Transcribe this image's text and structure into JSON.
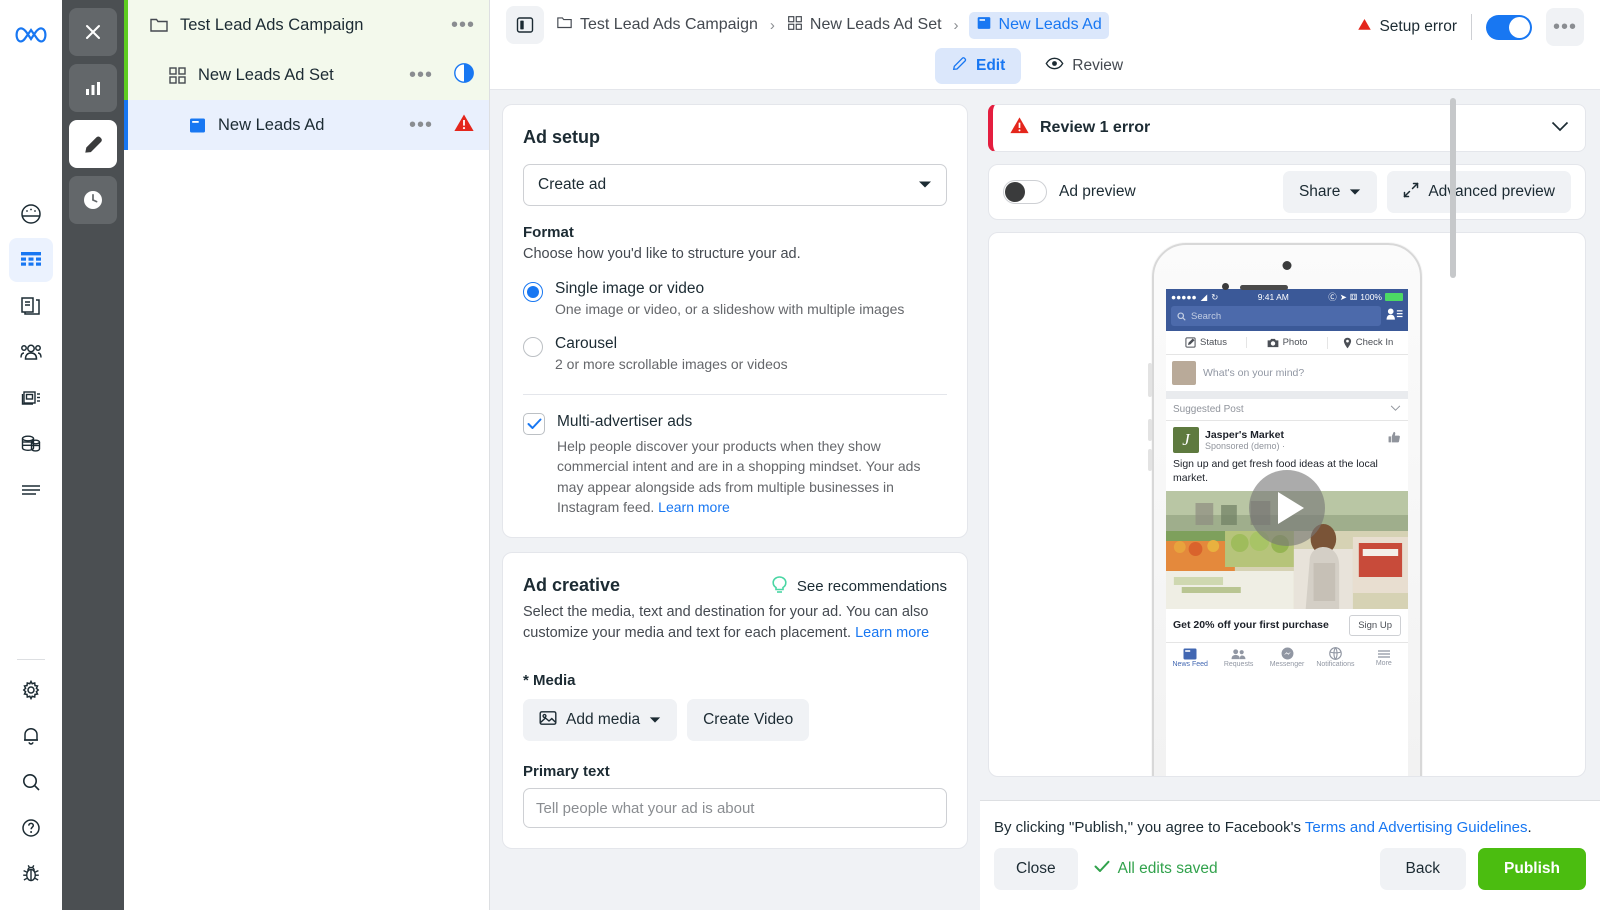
{
  "brand": {
    "logo": "meta-logo",
    "accent": "#1877f2",
    "green": "#4bbd10",
    "error_red": "#e41e3f"
  },
  "rail_left": {
    "top_items": [
      {
        "name": "performance-icon",
        "label": "Performance"
      },
      {
        "name": "table-icon",
        "label": "Campaigns",
        "active": true
      },
      {
        "name": "pages-icon",
        "label": "Pages"
      },
      {
        "name": "audiences-icon",
        "label": "Audiences"
      },
      {
        "name": "catalog-icon",
        "label": "Catalogue"
      },
      {
        "name": "billing-icon",
        "label": "Billing"
      },
      {
        "name": "menu-icon",
        "label": "All tools"
      }
    ],
    "bottom_items": [
      {
        "name": "gear-icon",
        "label": "Settings"
      },
      {
        "name": "bell-icon",
        "label": "Notifications"
      },
      {
        "name": "search-icon",
        "label": "Search"
      },
      {
        "name": "help-icon",
        "label": "Help"
      },
      {
        "name": "bug-icon",
        "label": "Report a bug"
      }
    ]
  },
  "rail_dark": {
    "items": [
      {
        "name": "close-icon",
        "label": "Close"
      },
      {
        "name": "chart-icon",
        "label": "Charts"
      },
      {
        "name": "edit-pencil-icon",
        "label": "Edit",
        "active": true
      },
      {
        "name": "clock-icon",
        "label": "History"
      }
    ]
  },
  "tree": {
    "rows": [
      {
        "icon": "folder-icon",
        "label": "Test Lead Ads Campaign",
        "level": "campaign",
        "status": null
      },
      {
        "icon": "grid-icon",
        "label": "New Leads Ad Set",
        "level": "adset",
        "status": "half-circle-icon"
      },
      {
        "icon": "ad-icon",
        "label": "New Leads Ad",
        "level": "ad",
        "status": "warning-triangle-icon"
      }
    ],
    "overflow_label": "•••"
  },
  "topbar": {
    "panel_toggle": "panel-toggle-icon",
    "breadcrumb": [
      {
        "icon": "folder-icon",
        "label": "Test Lead Ads Campaign",
        "active": false
      },
      {
        "icon": "grid-icon",
        "label": "New Leads Ad Set",
        "active": false
      },
      {
        "icon": "ad-icon",
        "label": "New Leads Ad",
        "active": true
      }
    ],
    "separator": "›",
    "setup_error": "Setup error",
    "toggle_on": true,
    "kebab": "•••",
    "tabs": [
      {
        "icon": "pencil-icon",
        "label": "Edit",
        "active": true
      },
      {
        "icon": "eye-icon",
        "label": "Review",
        "active": false
      }
    ]
  },
  "ad_setup": {
    "title": "Ad setup",
    "create_select_value": "Create ad",
    "format_label": "Format",
    "format_sub": "Choose how you'd like to structure your ad.",
    "options": [
      {
        "title": "Single image or video",
        "sub": "One image or video, or a slideshow with multiple images",
        "selected": true
      },
      {
        "title": "Carousel",
        "sub": "2 or more scrollable images or videos",
        "selected": false
      }
    ],
    "multi_advertiser": {
      "label": "Multi-advertiser ads",
      "checked": true,
      "description": "Help people discover your products when they show commercial intent and are in a shopping mindset. Your ads may appear alongside ads from multiple businesses in Instagram feed.",
      "link": "Learn more"
    }
  },
  "ad_creative": {
    "title": "Ad creative",
    "recommendations": "See recommendations",
    "recommendations_icon": "lightbulb-icon",
    "description": "Select the media, text and destination for your ad. You can also customize your media and text for each placement.",
    "link": "Learn more",
    "media_label": "* Media",
    "add_media_button": "Add media",
    "add_media_icon": "image-icon",
    "create_video_button": "Create Video",
    "primary_text_label": "Primary text",
    "primary_text_placeholder": "Tell people what your ad is about",
    "primary_text_value": ""
  },
  "review": {
    "title": "Review 1 error",
    "icon": "warning-triangle-icon",
    "chevron": "chevron-down-icon"
  },
  "preview": {
    "toggle_label": "Ad preview",
    "toggle_on": false,
    "share_button": "Share",
    "advanced_preview_button": "Advanced preview",
    "expand_icon": "expand-icon",
    "phone": {
      "status_time": "9:41 AM",
      "battery": "100%",
      "search_placeholder": "Search",
      "actions": [
        "Status",
        "Photo",
        "Check In"
      ],
      "composer_placeholder": "What's on your mind?",
      "suggested_label": "Suggested Post",
      "brand": "Jasper's Market",
      "brand_initial": "J",
      "sponsored": "Sponsored (demo) ·",
      "post_text": "Sign up and get fresh food ideas at the local market.",
      "cta_text": "Get 20% off your first purchase",
      "cta_button": "Sign Up",
      "tabs": [
        "News Feed",
        "Requests",
        "Messenger",
        "Notifications",
        "More"
      ]
    }
  },
  "bottom": {
    "legal_prefix": "By clicking \"Publish,\" you agree to Facebook's ",
    "legal_link": "Terms and Advertising Guidelines",
    "legal_suffix": ".",
    "close_button": "Close",
    "saved_status": "All edits saved",
    "back_button": "Back",
    "publish_button": "Publish"
  }
}
